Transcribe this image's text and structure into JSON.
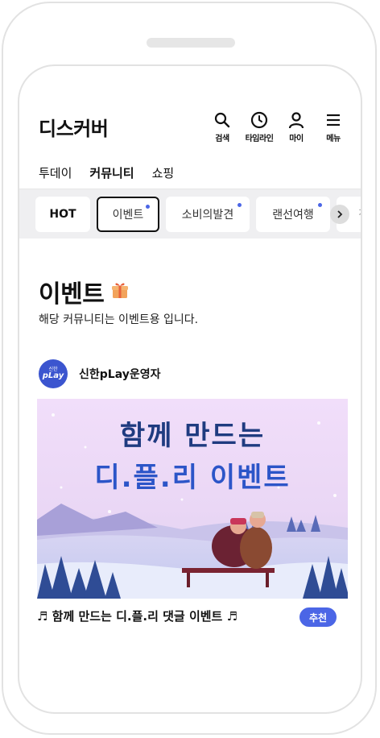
{
  "header": {
    "app_title": "디스커버",
    "icons": [
      {
        "name": "search-icon",
        "label": "검색"
      },
      {
        "name": "clock-icon",
        "label": "타임라인"
      },
      {
        "name": "person-icon",
        "label": "마이"
      },
      {
        "name": "menu-icon",
        "label": "메뉴"
      }
    ]
  },
  "tabs": [
    {
      "label": "투데이",
      "active": false
    },
    {
      "label": "커뮤니티",
      "active": true
    },
    {
      "label": "쇼핑",
      "active": false
    }
  ],
  "chips": [
    {
      "label": "HOT",
      "new_dot": false
    },
    {
      "label": "이벤트",
      "new_dot": true,
      "selected": true
    },
    {
      "label": "소비의발견",
      "new_dot": true
    },
    {
      "label": "랜선여행",
      "new_dot": true
    },
    {
      "label": "전",
      "new_dot": false
    }
  ],
  "community": {
    "title": "이벤트",
    "title_icon": "gift-icon",
    "description": "해당 커뮤니티는 이벤트용 입니다."
  },
  "post": {
    "author": "신한pLay운영자",
    "avatar_text_small": "신한",
    "avatar_text_large": "pLay",
    "banner_line1": "함께 만드는",
    "banner_line2": "디.플.리 이벤트",
    "title": "♬ 함께 만드는 디.플.리 댓글 이벤트 ♬",
    "badge": "추천"
  },
  "colors": {
    "accent": "#4b66e6",
    "banner_text": "#1f3b80",
    "chip_bar_bg": "#efeff1"
  }
}
